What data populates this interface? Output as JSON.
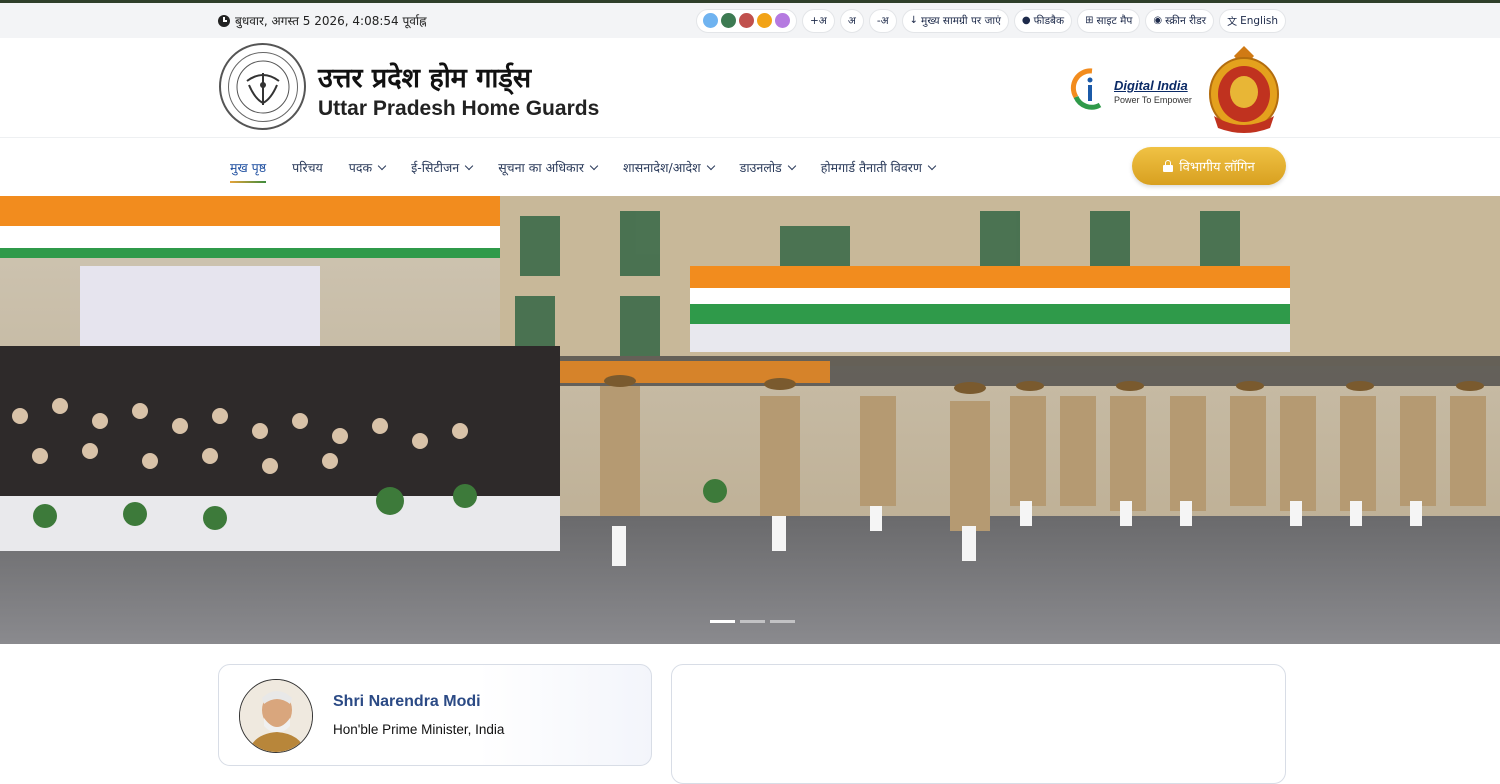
{
  "utility": {
    "datetime": "बुधवार, अगस्त 5 2026, 4:08:54 पूर्वाह्न",
    "theme_colors": [
      "#6fb3f0",
      "#3d7a52",
      "#c0504d",
      "#f2a316",
      "#b57ae0"
    ],
    "font_increase": "+अ",
    "font_normal": "अ",
    "font_decrease": "-अ",
    "skip_content": "मुख्य सामग्री पर जाएं",
    "feedback": "फीडबैक",
    "sitemap": "साइट मैप",
    "screen_reader": "स्क्रीन रीडर",
    "language": "English"
  },
  "header": {
    "title_hindi": "उत्तर प्रदेश होम गार्ड्स",
    "title_english": "Uttar Pradesh Home Guards",
    "digital_india": "Digital India",
    "digital_india_tagline": "Power To Empower"
  },
  "nav": {
    "items": [
      {
        "label": "मुख पृष्ठ",
        "active": true,
        "dropdown": false
      },
      {
        "label": "परिचय",
        "active": false,
        "dropdown": false
      },
      {
        "label": "पदक",
        "active": false,
        "dropdown": true
      },
      {
        "label": "ई-सिटीजन",
        "active": false,
        "dropdown": true
      },
      {
        "label": "सूचना का अधिकार",
        "active": false,
        "dropdown": true
      },
      {
        "label": "शासनादेश/आदेश",
        "active": false,
        "dropdown": true
      },
      {
        "label": "डाउनलोड",
        "active": false,
        "dropdown": true
      },
      {
        "label": "होमगार्ड तैनाती विवरण",
        "active": false,
        "dropdown": true
      }
    ],
    "login_label": "विभागीय लॉगिन"
  },
  "carousel": {
    "slide_count": 3,
    "active_index": 0
  },
  "pm_card": {
    "name": "Shri Narendra Modi",
    "role": "Hon'ble Prime Minister, India"
  }
}
